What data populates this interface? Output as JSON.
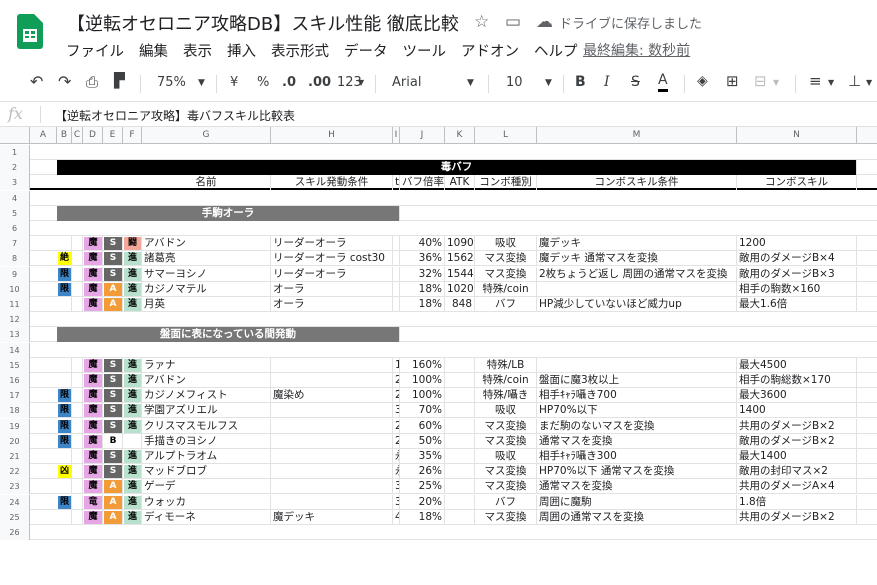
{
  "doc": {
    "title": "【逆転オセロニア攻略DB】スキル性能 徹底比較",
    "saved": "ドライブに保存しました",
    "last_edit": "最終編集: 数秒前"
  },
  "menu": [
    "ファイル",
    "編集",
    "表示",
    "挿入",
    "表示形式",
    "データ",
    "ツール",
    "アドオン",
    "ヘルプ"
  ],
  "toolbar": {
    "zoom": "75%",
    "currency": "¥",
    "percent": "%",
    "dec_less": ".0",
    "dec_more": ".00",
    "format": "123",
    "font": "Arial",
    "size": "10",
    "bold": "B",
    "italic": "I",
    "strike": "S",
    "textcolor": "A"
  },
  "formula": "【逆転オセロニア攻略】毒バフスキル比較表",
  "cols": [
    "A",
    "B",
    "C",
    "D",
    "E",
    "F",
    "G",
    "H",
    "I",
    "J",
    "K",
    "L",
    "M",
    "N"
  ],
  "colors": {
    "pink": "#e6a6e6",
    "gray": "#666666",
    "green": "#b7e1cd",
    "salmon": "#f4a69a",
    "orange": "#f29b38",
    "yellow": "#ffff00",
    "blue": "#3d85c6",
    "band": "#000000",
    "section": "#777777"
  },
  "banner": "毒バフ",
  "headers": {
    "name": "名前",
    "cond": "スキル発動条件",
    "t": "t",
    "pct": "バフ倍率",
    "atk": "ATK",
    "combo_type": "コンボ種別",
    "combo_cond": "コンボスキル条件",
    "combo_skill": "コンボスキル"
  },
  "sections": {
    "s1": "手駒オーラ",
    "s2": "盤面に表になっている間発動"
  },
  "rows1": [
    {
      "rownum": "7",
      "badge": "",
      "badge_color": "",
      "d": "魔",
      "e": "S",
      "e_color": "gray",
      "f": "闘",
      "f_color": "salmon",
      "name": "アバドン",
      "cond": "リーダーオーラ",
      "t": "",
      "pct": "40%",
      "atk": "1090",
      "ct": "吸収",
      "cc": "魔デッキ",
      "cs": "1200"
    },
    {
      "rownum": "8",
      "badge": "絶",
      "badge_color": "yellow",
      "d": "魔",
      "e": "S",
      "e_color": "gray",
      "f": "進",
      "f_color": "green",
      "name": "諸葛亮",
      "cond": "リーダーオーラ cost30",
      "t": "",
      "pct": "36%",
      "atk": "1562",
      "ct": "マス変換",
      "cc": "魔デッキ 通常マスを変換",
      "cs": "敵用のダメージB×4"
    },
    {
      "rownum": "9",
      "badge": "限",
      "badge_color": "blue",
      "d": "魔",
      "e": "S",
      "e_color": "gray",
      "f": "進",
      "f_color": "green",
      "name": "サマーヨシノ",
      "cond": "リーダーオーラ",
      "t": "",
      "pct": "32%",
      "atk": "1544",
      "ct": "マス変換",
      "cc": "2枚ちょうど返し 周囲の通常マスを変換",
      "cs": "敵用のダメージB×3"
    },
    {
      "rownum": "10",
      "badge": "限",
      "badge_color": "blue",
      "d": "魔",
      "e": "A",
      "e_color": "orange",
      "f": "進",
      "f_color": "green",
      "name": "カジノマテル",
      "cond": "オーラ",
      "t": "",
      "pct": "18%",
      "atk": "1020",
      "ct": "特殊/coin",
      "cc": "",
      "cs": "相手の駒数×160"
    },
    {
      "rownum": "11",
      "badge": "",
      "badge_color": "",
      "d": "魔",
      "e": "A",
      "e_color": "orange",
      "f": "進",
      "f_color": "green",
      "name": "月英",
      "cond": "オーラ",
      "t": "",
      "pct": "18%",
      "atk": "848",
      "ct": "バフ",
      "cc": "HP減少していないほど威力up",
      "cs": "最大1.6倍"
    }
  ],
  "rows2": [
    {
      "rownum": "15",
      "badge": "",
      "badge_color": "",
      "d": "魔",
      "e": "S",
      "e_color": "gray",
      "f": "進",
      "f_color": "green",
      "name": "ラァナ",
      "cond": "",
      "t": "1",
      "pct": "160%",
      "atk": "",
      "ct": "特殊/LB",
      "cc": "",
      "cs": "最大4500"
    },
    {
      "rownum": "16",
      "badge": "",
      "badge_color": "",
      "d": "魔",
      "e": "S",
      "e_color": "gray",
      "f": "進",
      "f_color": "green",
      "name": "アバドン",
      "cond": "",
      "t": "2",
      "pct": "100%",
      "atk": "",
      "ct": "特殊/coin",
      "cc": "盤面に魔3枚以上",
      "cs": "相手の駒総数×170"
    },
    {
      "rownum": "17",
      "badge": "限",
      "badge_color": "blue",
      "d": "魔",
      "e": "S",
      "e_color": "gray",
      "f": "進",
      "f_color": "green",
      "name": "カジノメフィスト",
      "cond": "魔染め",
      "t": "2",
      "pct": "100%",
      "atk": "",
      "ct": "特殊/囁き",
      "cc": "相手ｷｬﾗ囁き700",
      "cs": "最大3600"
    },
    {
      "rownum": "18",
      "badge": "限",
      "badge_color": "blue",
      "d": "魔",
      "e": "S",
      "e_color": "gray",
      "f": "進",
      "f_color": "green",
      "name": "学園アズリエル",
      "cond": "",
      "t": "3",
      "pct": "70%",
      "atk": "",
      "ct": "吸収",
      "cc": "HP70%以下",
      "cs": "1400"
    },
    {
      "rownum": "19",
      "badge": "限",
      "badge_color": "blue",
      "d": "魔",
      "e": "S",
      "e_color": "gray",
      "f": "進",
      "f_color": "green",
      "name": "クリスマスモルフス",
      "cond": "",
      "t": "2",
      "pct": "60%",
      "atk": "",
      "ct": "マス変換",
      "cc": "まだ駒のないマスを変換",
      "cs": "共用のダメージB×2"
    },
    {
      "rownum": "20",
      "badge": "限",
      "badge_color": "blue",
      "d": "魔",
      "e": "B",
      "e_color": "",
      "f": "",
      "f_color": "",
      "name": "手描きのヨシノ",
      "cond": "",
      "t": "2",
      "pct": "50%",
      "atk": "",
      "ct": "マス変換",
      "cc": "通常マスを変換",
      "cs": "敵用のダメージB×2"
    },
    {
      "rownum": "21",
      "badge": "",
      "badge_color": "",
      "d": "魔",
      "e": "S",
      "e_color": "gray",
      "f": "進",
      "f_color": "green",
      "name": "アルプトラオム",
      "cond": "",
      "t": "永",
      "pct": "35%",
      "atk": "",
      "ct": "吸収",
      "cc": "相手ｷｬﾗ囁き300",
      "cs": "最大1400"
    },
    {
      "rownum": "22",
      "badge": "凶",
      "badge_color": "yellow",
      "d": "魔",
      "e": "S",
      "e_color": "gray",
      "f": "進",
      "f_color": "green",
      "name": "マッドブロブ",
      "cond": "",
      "t": "永",
      "pct": "26%",
      "atk": "",
      "ct": "マス変換",
      "cc": "HP70%以下 通常マスを変換",
      "cs": "敵用の封印マス×2"
    },
    {
      "rownum": "23",
      "badge": "",
      "badge_color": "",
      "d": "魔",
      "e": "A",
      "e_color": "orange",
      "f": "進",
      "f_color": "green",
      "name": "ゲーデ",
      "cond": "",
      "t": "3",
      "pct": "25%",
      "atk": "",
      "ct": "マス変換",
      "cc": "通常マスを変換",
      "cs": "共用のダメージA×4"
    },
    {
      "rownum": "24",
      "badge": "限",
      "badge_color": "blue",
      "d": "竜",
      "e": "A",
      "e_color": "orange",
      "f": "進",
      "f_color": "green",
      "name": "ウォッカ",
      "cond": "",
      "t": "3",
      "pct": "20%",
      "atk": "",
      "ct": "バフ",
      "cc": "周囲に魔駒",
      "cs": "1.8倍"
    },
    {
      "rownum": "25",
      "badge": "",
      "badge_color": "",
      "d": "魔",
      "e": "A",
      "e_color": "orange",
      "f": "進",
      "f_color": "green",
      "name": "ディモーネ",
      "cond": "魔デッキ",
      "t": "4",
      "pct": "18%",
      "atk": "",
      "ct": "マス変換",
      "cc": "周囲の通常マスを変換",
      "cs": "共用のダメージB×2"
    }
  ],
  "blank_rows": [
    "1",
    "2",
    "4",
    "5",
    "6",
    "12",
    "13",
    "14",
    "26"
  ],
  "hdr_rownums": {
    "banner": "2",
    "headers": "3",
    "s1": "5",
    "s2": "13"
  }
}
